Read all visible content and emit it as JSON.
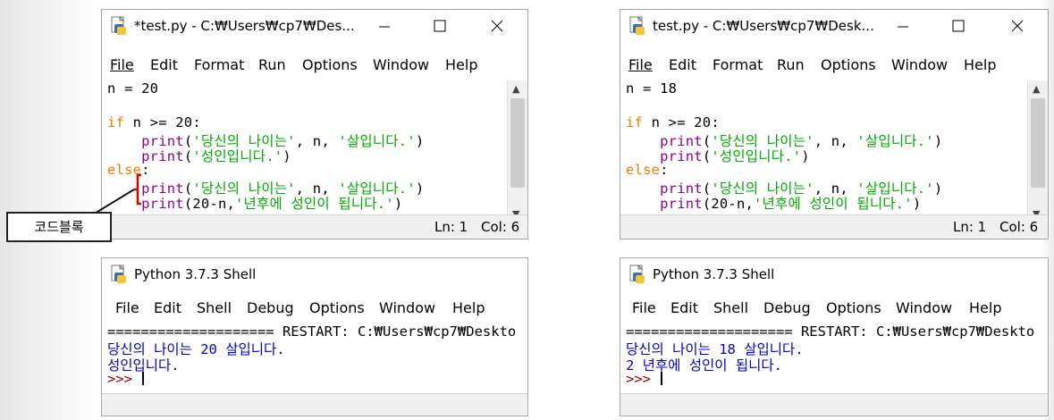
{
  "editor_left": {
    "title": "*test.py - C:₩Users₩cp7₩Des...",
    "menu": [
      "File",
      "Edit",
      "Format",
      "Run",
      "Options",
      "Window",
      "Help"
    ],
    "code": {
      "l1": "n = 20",
      "l2_kw": "if",
      "l2_rest": " n >= 20:",
      "print": "print",
      "s_age": "'당신의 나이는'",
      "mid_n": ", n, ",
      "s_years": "'살입니다.'",
      "s_adult": "'성인입니다.'",
      "else": "else",
      "colon": ":",
      "calc": "(20-n,",
      "s_wait": "'년후에 성인이 됩니다.'",
      "open": "(",
      "close": ")"
    },
    "status": {
      "ln": "Ln: 1",
      "col": "Col: 6"
    }
  },
  "editor_right": {
    "title": "test.py - C:₩Users₩cp7₩Desk...",
    "menu": [
      "File",
      "Edit",
      "Format",
      "Run",
      "Options",
      "Window",
      "Help"
    ],
    "code": {
      "l1": "n = 18"
    },
    "status": {
      "ln": "Ln: 1",
      "col": "Col: 6"
    }
  },
  "shell_left": {
    "title": "Python 3.7.3 Shell",
    "menu": [
      "File",
      "Edit",
      "Shell",
      "Debug",
      "Options",
      "Window",
      "Help"
    ],
    "restart": "==================== RESTART: C:₩Users₩cp7₩Deskto",
    "out1": "당신의 나이는 20 살입니다.",
    "out2": "성인입니다.",
    "prompt": ">>> "
  },
  "shell_right": {
    "title": "Python 3.7.3 Shell",
    "menu": [
      "File",
      "Edit",
      "Shell",
      "Debug",
      "Options",
      "Window",
      "Help"
    ],
    "restart": "==================== RESTART: C:₩Users₩cp7₩Deskto",
    "out1": "당신의 나이는 18 살입니다.",
    "out2": "2 년후에 성인이 됩니다.",
    "prompt": ">>> "
  },
  "callout": {
    "label": "코드블록"
  },
  "icons": {
    "app": "python-file-icon",
    "minimize": "minimize-icon",
    "maximize": "maximize-icon",
    "close": "close-icon",
    "scroll_up": "scroll-up-icon",
    "scroll_down": "scroll-down-icon"
  },
  "colors": {
    "keyword": "#ff7700",
    "builtin": "#900090",
    "string": "#00aa00",
    "shell_output": "#0000cc",
    "prompt": "#990000",
    "annotation": "#e00000"
  }
}
